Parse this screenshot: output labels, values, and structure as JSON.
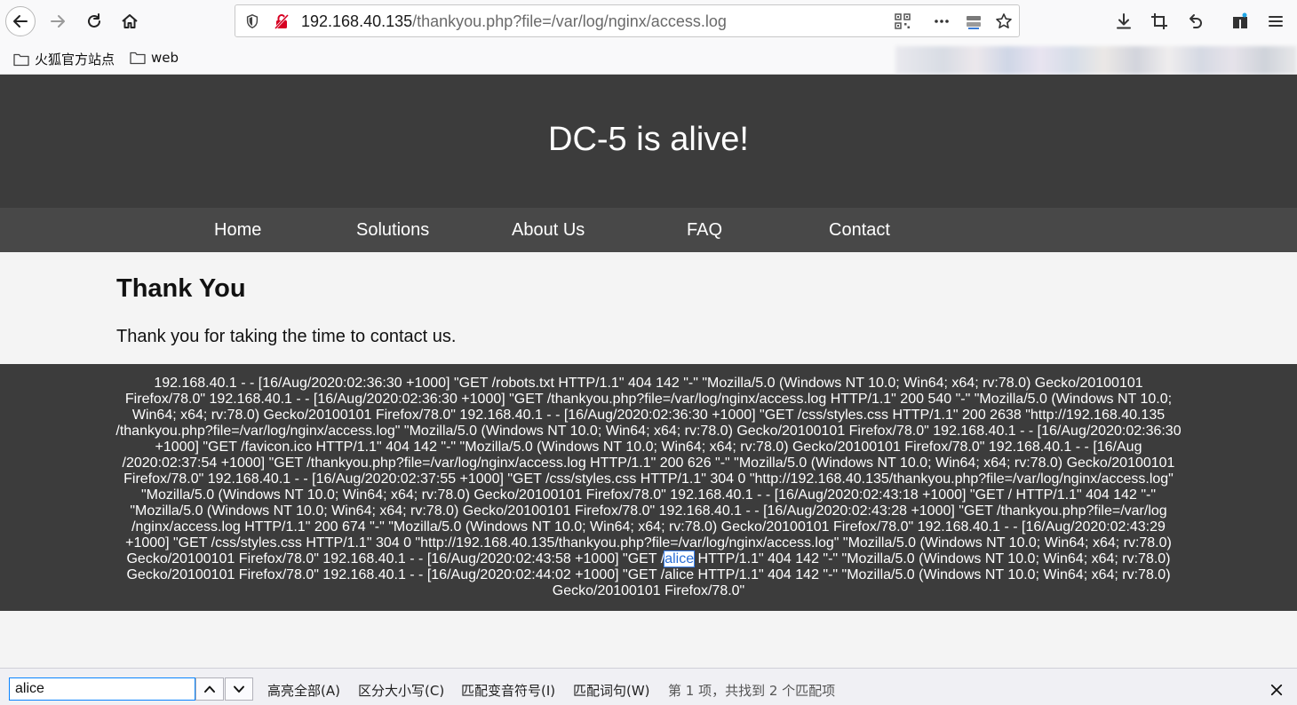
{
  "browser": {
    "url_host": "192.168.40.135",
    "url_path": "/thankyou.php?file=/var/log/nginx/access.log",
    "bookmarks": [
      "火狐官方站点",
      "web"
    ]
  },
  "site": {
    "title": "DC-5 is alive!",
    "nav": [
      "Home",
      "Solutions",
      "About Us",
      "FAQ",
      "Contact"
    ],
    "heading": "Thank You",
    "message": "Thank you for taking the time to contact us."
  },
  "log": {
    "before": "192.168.40.1 - - [16/Aug/2020:02:36:30 +1000] \"GET /robots.txt HTTP/1.1\" 404 142 \"-\" \"Mozilla/5.0 (Windows NT 10.0; Win64; x64; rv:78.0) Gecko/20100101 Firefox/78.0\" 192.168.40.1 - - [16/Aug/2020:02:36:30 +1000] \"GET /thankyou.php?file=/var/log/nginx/access.log HTTP/1.1\" 200 540 \"-\" \"Mozilla/5.0 (Windows NT 10.0; Win64; x64; rv:78.0) Gecko/20100101 Firefox/78.0\" 192.168.40.1 - - [16/Aug/2020:02:36:30 +1000] \"GET /css/styles.css HTTP/1.1\" 200 2638 \"http://192.168.40.135 /thankyou.php?file=/var/log/nginx/access.log\" \"Mozilla/5.0 (Windows NT 10.0; Win64; x64; rv:78.0) Gecko/20100101 Firefox/78.0\" 192.168.40.1 - - [16/Aug/2020:02:36:30 +1000] \"GET /favicon.ico HTTP/1.1\" 404 142 \"-\" \"Mozilla/5.0 (Windows NT 10.0; Win64; x64; rv:78.0) Gecko/20100101 Firefox/78.0\" 192.168.40.1 - - [16/Aug /2020:02:37:54 +1000] \"GET /thankyou.php?file=/var/log/nginx/access.log HTTP/1.1\" 200 626 \"-\" \"Mozilla/5.0 (Windows NT 10.0; Win64; x64; rv:78.0) Gecko/20100101 Firefox/78.0\" 192.168.40.1 - - [16/Aug/2020:02:37:55 +1000] \"GET /css/styles.css HTTP/1.1\" 304 0 \"http://192.168.40.135/thankyou.php?file=/var/log/nginx/access.log\" \"Mozilla/5.0 (Windows NT 10.0; Win64; x64; rv:78.0) Gecko/20100101 Firefox/78.0\" 192.168.40.1 - - [16/Aug/2020:02:43:18 +1000] \"GET / HTTP/1.1\" 404 142 \"-\" \"Mozilla/5.0 (Windows NT 10.0; Win64; x64; rv:78.0) Gecko/20100101 Firefox/78.0\" 192.168.40.1 - - [16/Aug/2020:02:43:28 +1000] \"GET /thankyou.php?file=/var/log /nginx/access.log HTTP/1.1\" 200 674 \"-\" \"Mozilla/5.0 (Windows NT 10.0; Win64; x64; rv:78.0) Gecko/20100101 Firefox/78.0\" 192.168.40.1 - - [16/Aug/2020:02:43:29 +1000] \"GET /css/styles.css HTTP/1.1\" 304 0 \"http://192.168.40.135/thankyou.php?file=/var/log/nginx/access.log\" \"Mozilla/5.0 (Windows NT 10.0; Win64; x64; rv:78.0) Gecko/20100101 Firefox/78.0\" 192.168.40.1 - - [16/Aug/2020:02:43:58 +1000] \"GET /",
    "highlight": "alice",
    "after": " HTTP/1.1\" 404 142 \"-\" \"Mozilla/5.0 (Windows NT 10.0; Win64; x64; rv:78.0) Gecko/20100101 Firefox/78.0\" 192.168.40.1 - - [16/Aug/2020:02:44:02 +1000] \"GET /alice HTTP/1.1\" 404 142 \"-\" \"Mozilla/5.0 (Windows NT 10.0; Win64; x64; rv:78.0) Gecko/20100101 Firefox/78.0\""
  },
  "findbar": {
    "query": "alice",
    "highlight_all": "高亮全部(A)",
    "match_case": "区分大小写(C)",
    "match_diacritics": "匹配变音符号(I)",
    "whole_words": "匹配词句(W)",
    "status": "第 1 项，共找到 2 个匹配项"
  },
  "colors": {
    "header_bg": "#3c3c3c",
    "nav_bg": "#484848",
    "page_bg": "#f4f4f4",
    "find_focus": "#0a84ff",
    "insecure_icon": "#d70022"
  }
}
